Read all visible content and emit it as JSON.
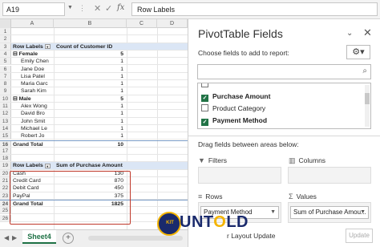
{
  "formula_bar": {
    "name_box": "A19",
    "formula": "Row Labels"
  },
  "columns": [
    "A",
    "B",
    "C",
    "D"
  ],
  "rows": [
    {
      "n": "1",
      "a": "",
      "b": ""
    },
    {
      "n": "2",
      "a": "",
      "b": ""
    },
    {
      "n": "3",
      "a": "Row Labels",
      "b": "Count of Customer ID",
      "kind": "header"
    },
    {
      "n": "4",
      "a": "⊟ Female",
      "b": "5",
      "kind": "group"
    },
    {
      "n": "5",
      "a": "Emily Chen",
      "b": "1",
      "kind": "item"
    },
    {
      "n": "6",
      "a": "Jane Doe",
      "b": "1",
      "kind": "item"
    },
    {
      "n": "7",
      "a": "Lisa Patel",
      "b": "1",
      "kind": "item"
    },
    {
      "n": "8",
      "a": "Maria Garc",
      "b": "1",
      "kind": "item"
    },
    {
      "n": "9",
      "a": "Sarah Kim",
      "b": "1",
      "kind": "item"
    },
    {
      "n": "10",
      "a": "⊟ Male",
      "b": "5",
      "kind": "group"
    },
    {
      "n": "11",
      "a": "Alex Wong",
      "b": "1",
      "kind": "item"
    },
    {
      "n": "12",
      "a": "David Bro",
      "b": "1",
      "kind": "item"
    },
    {
      "n": "13",
      "a": "John Smit",
      "b": "1",
      "kind": "item"
    },
    {
      "n": "14",
      "a": "Michael Le",
      "b": "1",
      "kind": "item"
    },
    {
      "n": "15",
      "a": "Robert Jo",
      "b": "1",
      "kind": "item"
    },
    {
      "n": "16",
      "a": "Grand Total",
      "b": "10",
      "kind": "grand"
    },
    {
      "n": "17",
      "a": "",
      "b": ""
    },
    {
      "n": "18",
      "a": "",
      "b": ""
    },
    {
      "n": "19",
      "a": "Row Labels",
      "b": "Sum of Purchase Amount",
      "kind": "header"
    },
    {
      "n": "20",
      "a": "Cash",
      "b": "130",
      "kind": "plain"
    },
    {
      "n": "21",
      "a": "Credit Card",
      "b": "870",
      "kind": "plain"
    },
    {
      "n": "22",
      "a": "Debit Card",
      "b": "450",
      "kind": "plain"
    },
    {
      "n": "23",
      "a": "PayPal",
      "b": "375",
      "kind": "plain"
    },
    {
      "n": "24",
      "a": "Grand Total",
      "b": "1825",
      "kind": "grand"
    },
    {
      "n": "25",
      "a": "",
      "b": ""
    },
    {
      "n": "26",
      "a": "",
      "b": ""
    }
  ],
  "sheet_tabs": {
    "active": "Sheet4",
    "add": "+",
    "prev": "◀",
    "next": "▶"
  },
  "panel": {
    "title": "PivotTable Fields",
    "choose_label": "Choose fields to add to report:",
    "fields": [
      {
        "label": "Purchase Amount",
        "checked": true
      },
      {
        "label": "Product Category",
        "checked": false
      },
      {
        "label": "Payment Method",
        "checked": true
      }
    ],
    "drag_label": "Drag fields between areas below:",
    "areas": {
      "filters": "Filters",
      "columns": "Columns",
      "rows": "Rows",
      "values": "Values",
      "rows_chip": "Payment Method",
      "values_chip": "Sum of Purchase Amou..."
    },
    "defer_label": "r Layout Update",
    "update_button": "Update"
  },
  "logo": {
    "text_left": "UNT",
    "text_o": "O",
    "text_right": "LD",
    "ring_text": "KIT"
  }
}
